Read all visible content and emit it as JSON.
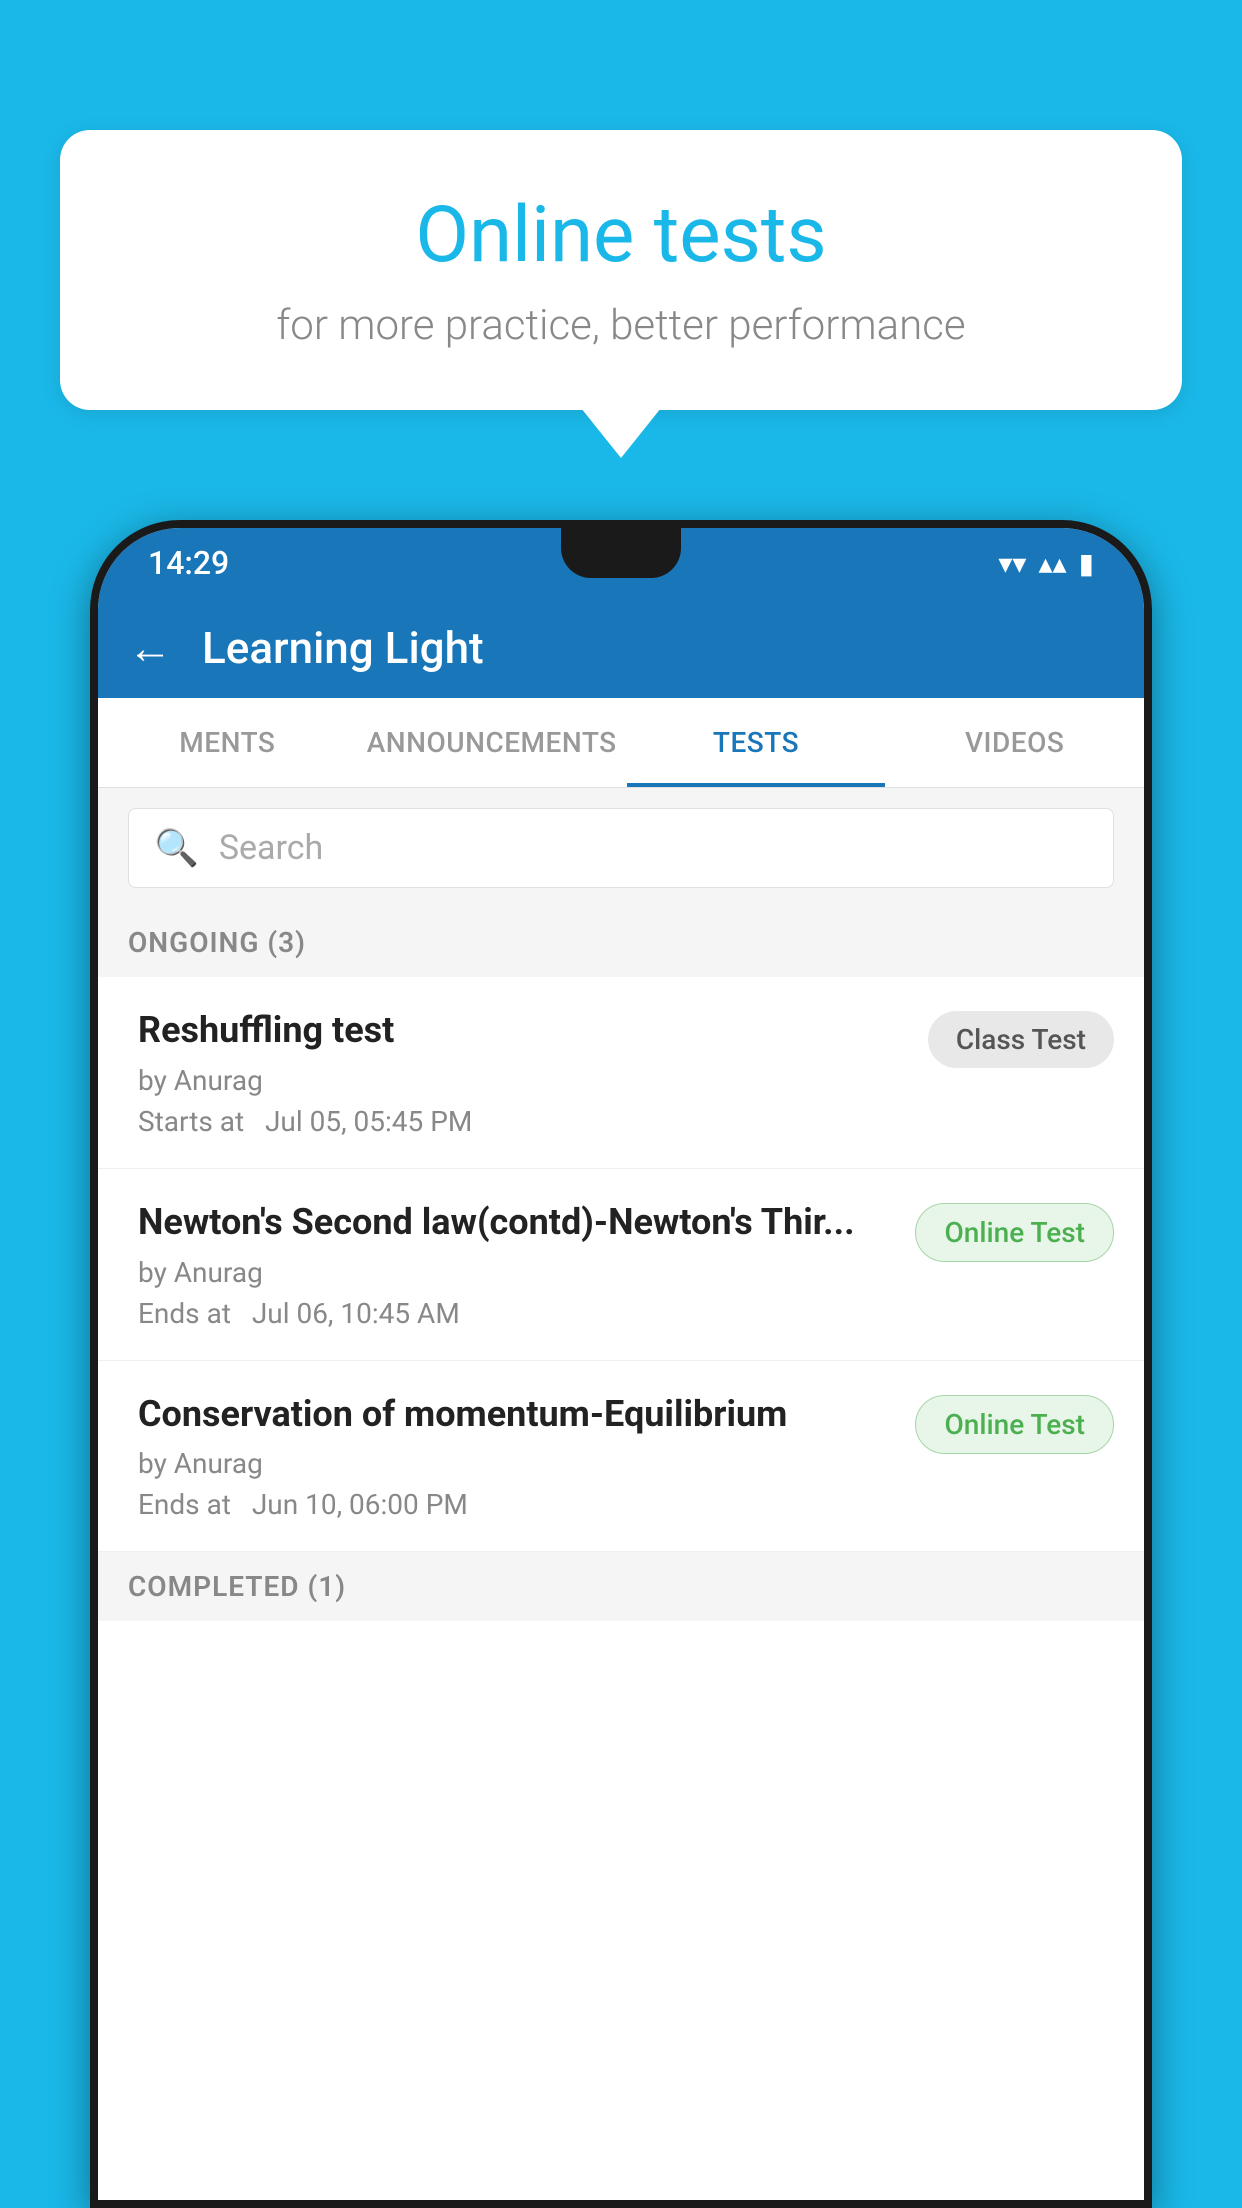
{
  "background": {
    "color": "#1ab8e8"
  },
  "speech_bubble": {
    "title": "Online tests",
    "subtitle": "for more practice, better performance"
  },
  "phone": {
    "status_bar": {
      "time": "14:29",
      "wifi_icon": "▾",
      "signal_icon": "▴▴",
      "battery_icon": "▮"
    },
    "header": {
      "back_label": "←",
      "title": "Learning Light"
    },
    "tabs": [
      {
        "label": "MENTS",
        "active": false
      },
      {
        "label": "ANNOUNCEMENTS",
        "active": false
      },
      {
        "label": "TESTS",
        "active": true
      },
      {
        "label": "VIDEOS",
        "active": false
      }
    ],
    "search": {
      "placeholder": "Search"
    },
    "ongoing_section": {
      "label": "ONGOING (3)"
    },
    "test_items": [
      {
        "title": "Reshuffling test",
        "author": "by Anurag",
        "time_label": "Starts at",
        "time": "Jul 05, 05:45 PM",
        "badge": "Class Test",
        "badge_type": "class"
      },
      {
        "title": "Newton's Second law(contd)-Newton's Thir...",
        "author": "by Anurag",
        "time_label": "Ends at",
        "time": "Jul 06, 10:45 AM",
        "badge": "Online Test",
        "badge_type": "online"
      },
      {
        "title": "Conservation of momentum-Equilibrium",
        "author": "by Anurag",
        "time_label": "Ends at",
        "time": "Jun 10, 06:00 PM",
        "badge": "Online Test",
        "badge_type": "online"
      }
    ],
    "completed_section": {
      "label": "COMPLETED (1)"
    }
  }
}
